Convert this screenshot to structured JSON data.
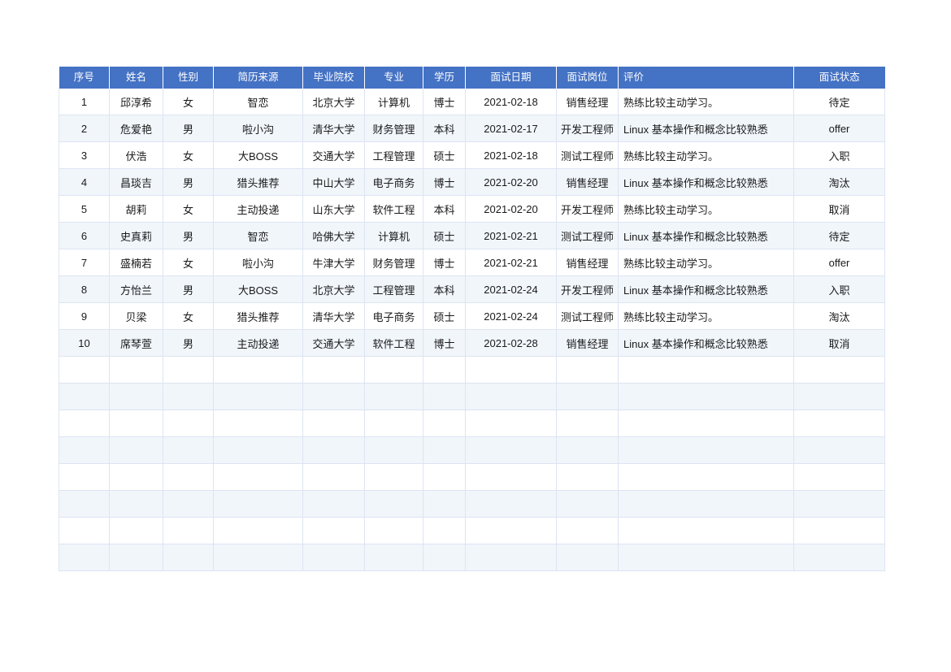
{
  "table": {
    "name": "interview-records-table",
    "accent_color": "#4472C4",
    "header_text_color": "#FFFFFF",
    "row_alt_color": "#F1F6FB",
    "grid_line_color": "#DDE4F2",
    "columns": [
      {
        "key": "seq",
        "label": "序号",
        "align": "center"
      },
      {
        "key": "name",
        "label": "姓名",
        "align": "center"
      },
      {
        "key": "gender",
        "label": "性别",
        "align": "center"
      },
      {
        "key": "source",
        "label": "简历来源",
        "align": "center"
      },
      {
        "key": "school",
        "label": "毕业院校",
        "align": "center"
      },
      {
        "key": "major",
        "label": "专业",
        "align": "center"
      },
      {
        "key": "degree",
        "label": "学历",
        "align": "center"
      },
      {
        "key": "date",
        "label": "面试日期",
        "align": "center"
      },
      {
        "key": "position",
        "label": "面试岗位",
        "align": "center"
      },
      {
        "key": "eval",
        "label": "评价",
        "align": "left"
      },
      {
        "key": "status",
        "label": "面试状态",
        "align": "center"
      }
    ],
    "rows": [
      {
        "seq": "1",
        "name": "邱淳希",
        "gender": "女",
        "source": "智恋",
        "school": "北京大学",
        "major": "计算机",
        "degree": "博士",
        "date": "2021-02-18",
        "position": "销售经理",
        "eval": "熟练比较主动学习。",
        "status": "待定"
      },
      {
        "seq": "2",
        "name": "危爱艳",
        "gender": "男",
        "source": "啦小沟",
        "school": "清华大学",
        "major": "财务管理",
        "degree": "本科",
        "date": "2021-02-17",
        "position": "开发工程师",
        "eval": "Linux 基本操作和概念比较熟悉",
        "status": "offer"
      },
      {
        "seq": "3",
        "name": "伏浩",
        "gender": "女",
        "source": "大BOSS",
        "school": "交通大学",
        "major": "工程管理",
        "degree": "硕士",
        "date": "2021-02-18",
        "position": "测试工程师",
        "eval": "熟练比较主动学习。",
        "status": "入职"
      },
      {
        "seq": "4",
        "name": "昌琰吉",
        "gender": "男",
        "source": "猎头推荐",
        "school": "中山大学",
        "major": "电子商务",
        "degree": "博士",
        "date": "2021-02-20",
        "position": "销售经理",
        "eval": "Linux 基本操作和概念比较熟悉",
        "status": "淘汰"
      },
      {
        "seq": "5",
        "name": "胡莉",
        "gender": "女",
        "source": "主动投递",
        "school": "山东大学",
        "major": "软件工程",
        "degree": "本科",
        "date": "2021-02-20",
        "position": "开发工程师",
        "eval": "熟练比较主动学习。",
        "status": "取消"
      },
      {
        "seq": "6",
        "name": "史真莉",
        "gender": "男",
        "source": "智恋",
        "school": "哈佛大学",
        "major": "计算机",
        "degree": "硕士",
        "date": "2021-02-21",
        "position": "测试工程师",
        "eval": "Linux 基本操作和概念比较熟悉",
        "status": "待定"
      },
      {
        "seq": "7",
        "name": "盛楠若",
        "gender": "女",
        "source": "啦小沟",
        "school": "牛津大学",
        "major": "财务管理",
        "degree": "博士",
        "date": "2021-02-21",
        "position": "销售经理",
        "eval": "熟练比较主动学习。",
        "status": "offer"
      },
      {
        "seq": "8",
        "name": "方怡兰",
        "gender": "男",
        "source": "大BOSS",
        "school": "北京大学",
        "major": "工程管理",
        "degree": "本科",
        "date": "2021-02-24",
        "position": "开发工程师",
        "eval": "Linux 基本操作和概念比较熟悉",
        "status": "入职"
      },
      {
        "seq": "9",
        "name": "贝梁",
        "gender": "女",
        "source": "猎头推荐",
        "school": "清华大学",
        "major": "电子商务",
        "degree": "硕士",
        "date": "2021-02-24",
        "position": "测试工程师",
        "eval": "熟练比较主动学习。",
        "status": "淘汰"
      },
      {
        "seq": "10",
        "name": "席琴萱",
        "gender": "男",
        "source": "主动投递",
        "school": "交通大学",
        "major": "软件工程",
        "degree": "博士",
        "date": "2021-02-28",
        "position": "销售经理",
        "eval": "Linux 基本操作和概念比较熟悉",
        "status": "取消"
      },
      {
        "seq": "",
        "name": "",
        "gender": "",
        "source": "",
        "school": "",
        "major": "",
        "degree": "",
        "date": "",
        "position": "",
        "eval": "",
        "status": ""
      },
      {
        "seq": "",
        "name": "",
        "gender": "",
        "source": "",
        "school": "",
        "major": "",
        "degree": "",
        "date": "",
        "position": "",
        "eval": "",
        "status": ""
      },
      {
        "seq": "",
        "name": "",
        "gender": "",
        "source": "",
        "school": "",
        "major": "",
        "degree": "",
        "date": "",
        "position": "",
        "eval": "",
        "status": ""
      },
      {
        "seq": "",
        "name": "",
        "gender": "",
        "source": "",
        "school": "",
        "major": "",
        "degree": "",
        "date": "",
        "position": "",
        "eval": "",
        "status": ""
      },
      {
        "seq": "",
        "name": "",
        "gender": "",
        "source": "",
        "school": "",
        "major": "",
        "degree": "",
        "date": "",
        "position": "",
        "eval": "",
        "status": ""
      },
      {
        "seq": "",
        "name": "",
        "gender": "",
        "source": "",
        "school": "",
        "major": "",
        "degree": "",
        "date": "",
        "position": "",
        "eval": "",
        "status": ""
      },
      {
        "seq": "",
        "name": "",
        "gender": "",
        "source": "",
        "school": "",
        "major": "",
        "degree": "",
        "date": "",
        "position": "",
        "eval": "",
        "status": ""
      },
      {
        "seq": "",
        "name": "",
        "gender": "",
        "source": "",
        "school": "",
        "major": "",
        "degree": "",
        "date": "",
        "position": "",
        "eval": "",
        "status": ""
      }
    ]
  }
}
